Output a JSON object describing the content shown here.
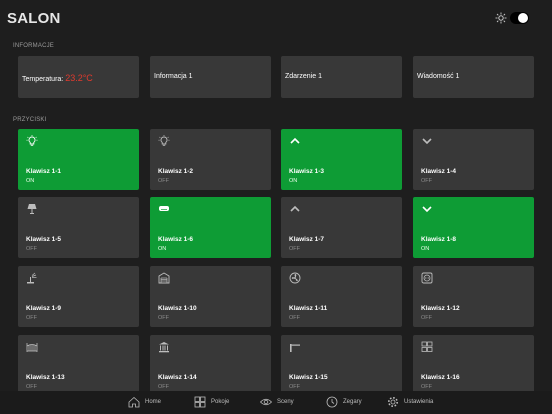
{
  "header": {
    "title": "SALON",
    "theme_toggle": {
      "state": "dark"
    }
  },
  "sections": {
    "info_title": "INFORMACJE",
    "buttons_title": "PRZYCISKI"
  },
  "info": [
    {
      "label": "Temperatura: ",
      "value": "23.2°C"
    },
    {
      "label": "Informacja 1"
    },
    {
      "label": "Zdarzenie 1"
    },
    {
      "label": "Wiadomość 1"
    }
  ],
  "buttons": [
    {
      "name": "Klawisz 1-1",
      "state": "ON",
      "icon": "lightbulb-icon"
    },
    {
      "name": "Klawisz 1-2",
      "state": "OFF",
      "icon": "lightbulb-icon"
    },
    {
      "name": "Klawisz 1-3",
      "state": "ON",
      "icon": "chevron-up-icon"
    },
    {
      "name": "Klawisz 1-4",
      "state": "OFF",
      "icon": "chevron-down-icon"
    },
    {
      "name": "Klawisz 1-5",
      "state": "OFF",
      "icon": "lamp-icon"
    },
    {
      "name": "Klawisz 1-6",
      "state": "ON",
      "icon": "air-conditioner-icon"
    },
    {
      "name": "Klawisz 1-7",
      "state": "OFF",
      "icon": "chevron-up-icon"
    },
    {
      "name": "Klawisz 1-8",
      "state": "ON",
      "icon": "chevron-down-icon"
    },
    {
      "name": "Klawisz 1-9",
      "state": "OFF",
      "icon": "sprinkler-icon"
    },
    {
      "name": "Klawisz 1-10",
      "state": "OFF",
      "icon": "garage-icon"
    },
    {
      "name": "Klawisz 1-11",
      "state": "OFF",
      "icon": "fan-icon"
    },
    {
      "name": "Klawisz 1-12",
      "state": "OFF",
      "icon": "socket-icon"
    },
    {
      "name": "Klawisz 1-13",
      "state": "OFF",
      "icon": "gate-icon"
    },
    {
      "name": "Klawisz 1-14",
      "state": "OFF",
      "icon": "building-icon"
    },
    {
      "name": "Klawisz 1-15",
      "state": "OFF",
      "icon": "barrier-icon"
    },
    {
      "name": "Klawisz 1-16",
      "state": "OFF",
      "icon": "blinds-icon"
    }
  ],
  "nav": [
    {
      "label": "Home",
      "icon": "home-icon"
    },
    {
      "label": "Pokoje",
      "icon": "rooms-icon"
    },
    {
      "label": "Sceny",
      "icon": "eye-icon"
    },
    {
      "label": "Zegary",
      "icon": "clock-icon"
    },
    {
      "label": "Ustawienia",
      "icon": "gear-icon"
    }
  ],
  "colors": {
    "on": "#0e9c35",
    "off": "#383838",
    "temperature": "#e03a2e",
    "background": "#1e1e1e"
  }
}
